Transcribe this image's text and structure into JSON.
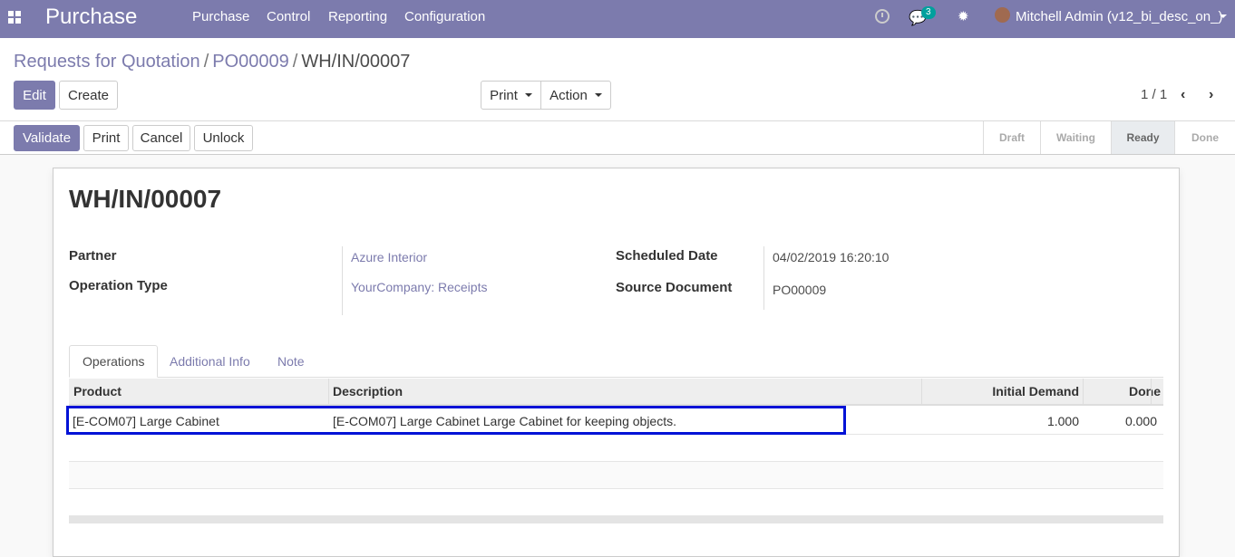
{
  "navbar": {
    "brand": "Purchase",
    "menus": [
      "Purchase",
      "Control",
      "Reporting",
      "Configuration"
    ],
    "chat_badge": "3",
    "user": "Mitchell Admin (v12_bi_desc_on_)",
    "icons": [
      "apps-icon",
      "clock-icon",
      "chat-icon",
      "bug-icon",
      "avatar"
    ]
  },
  "breadcrumb": {
    "items": [
      "Requests for Quotation",
      "PO00009"
    ],
    "current": "WH/IN/00007",
    "separator": "/"
  },
  "control": {
    "edit": "Edit",
    "create": "Create",
    "print": "Print",
    "action": "Action",
    "pager": "1 / 1"
  },
  "statusbar": {
    "buttons": [
      "Validate",
      "Print",
      "Cancel",
      "Unlock"
    ],
    "stages": [
      "Draft",
      "Waiting",
      "Ready",
      "Done"
    ],
    "active_stage": "Ready"
  },
  "record": {
    "title": "WH/IN/00007",
    "partner_label": "Partner",
    "partner": "Azure Interior",
    "operation_type_label": "Operation Type",
    "operation_type": "YourCompany: Receipts",
    "scheduled_date_label": "Scheduled Date",
    "scheduled_date": "04/02/2019 16:20:10",
    "source_document_label": "Source Document",
    "source_document": "PO00009"
  },
  "tabs": [
    "Operations",
    "Additional Info",
    "Note"
  ],
  "table": {
    "columns": [
      "Product",
      "Description",
      "Initial Demand",
      "Done"
    ],
    "rows": [
      {
        "product": "[E-COM07] Large Cabinet",
        "description": "[E-COM07] Large Cabinet Large Cabinet for keeping objects.",
        "initial_demand": "1.000",
        "done": "0.000"
      }
    ]
  },
  "colors": {
    "brand": "#7c7bad",
    "highlight": "#0012d6",
    "badge": "#00a09d"
  }
}
